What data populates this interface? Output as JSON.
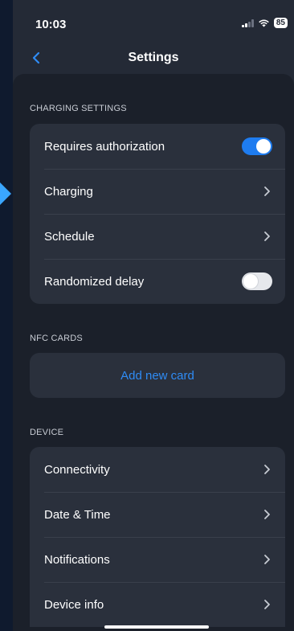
{
  "status_bar": {
    "time": "10:03",
    "battery": "85"
  },
  "nav": {
    "title": "Settings"
  },
  "charging_settings": {
    "header": "CHARGING SETTINGS",
    "items": [
      {
        "label": "Requires authorization",
        "control": "toggle",
        "on": true
      },
      {
        "label": "Charging",
        "control": "chevron"
      },
      {
        "label": "Schedule",
        "control": "chevron"
      },
      {
        "label": "Randomized delay",
        "control": "toggle",
        "on": false
      }
    ]
  },
  "nfc_cards": {
    "header": "NFC CARDS",
    "add_label": "Add new card"
  },
  "device": {
    "header": "DEVICE",
    "items": [
      {
        "label": "Connectivity",
        "control": "chevron"
      },
      {
        "label": "Date & Time",
        "control": "chevron"
      },
      {
        "label": "Notifications",
        "control": "chevron"
      },
      {
        "label": "Device info",
        "control": "chevron"
      }
    ]
  },
  "colors": {
    "accent": "#1e7cf0",
    "link": "#2f8cf5",
    "background": "#1b202a",
    "card": "#2a303c"
  }
}
